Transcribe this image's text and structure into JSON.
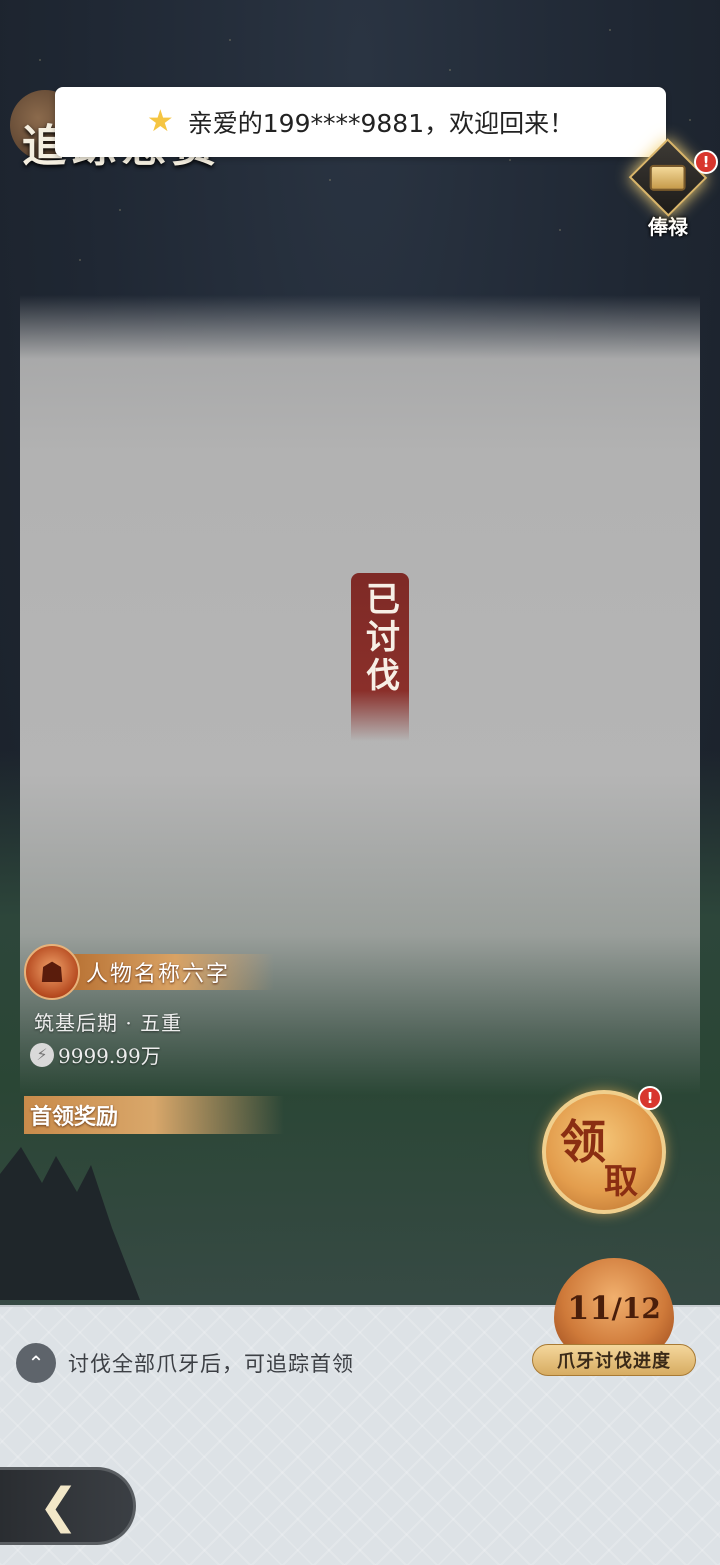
{
  "toast": {
    "icon": "star-icon",
    "message": "亲爱的199****9881，欢迎回来！"
  },
  "header": {
    "title": "追踪悬赏"
  },
  "salary": {
    "label": "俸禄",
    "badge": "!"
  },
  "boss": {
    "status": "已讨伐"
  },
  "character": {
    "name": "人物名称六字",
    "realm": "筑基后期 · 五重",
    "power": "9999.99万"
  },
  "reward": {
    "title": "首领奖励"
  },
  "claim": {
    "char1": "领",
    "char2": "取",
    "badge": "!"
  },
  "progress": {
    "current": "11",
    "separator": "/",
    "total": "12",
    "label": "爪牙讨伐进度"
  },
  "hint": {
    "text": "讨伐全部爪牙后，可追踪首领"
  },
  "colors": {
    "accent": "#d8a264",
    "seal": "#8a2f2a",
    "badge": "#d8362e"
  }
}
